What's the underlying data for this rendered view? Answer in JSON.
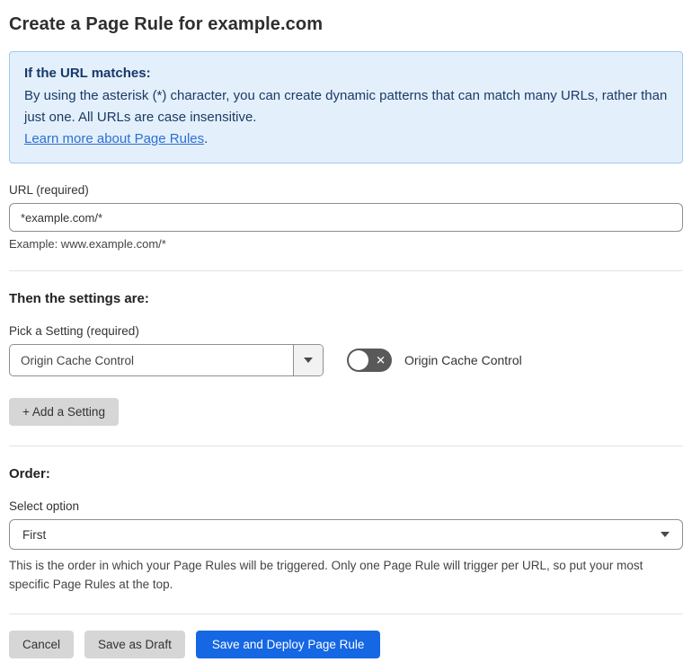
{
  "page": {
    "title": "Create a Page Rule for example.com"
  },
  "info_box": {
    "heading": "If the URL matches:",
    "body": "By using the asterisk (*) character, you can create dynamic patterns that can match many URLs, rather than just one. All URLs are case insensitive.",
    "link_label": "Learn more about Page Rules",
    "link_suffix": "."
  },
  "url_field": {
    "label": "URL (required)",
    "value": "*example.com/*",
    "helper": "Example: www.example.com/*"
  },
  "settings_section": {
    "heading": "Then the settings are:",
    "picker_label": "Pick a Setting (required)",
    "picker_value": "Origin Cache Control",
    "toggle_label": "Origin Cache Control",
    "toggle_state": "off",
    "toggle_icon": "✕",
    "add_setting_label": "+ Add a Setting"
  },
  "order_section": {
    "heading": "Order:",
    "select_label": "Select option",
    "select_value": "First",
    "helper": "This is the order in which your Page Rules will be triggered. Only one Page Rule will trigger per URL, so put your most specific Page Rules at the top."
  },
  "footer": {
    "cancel_label": "Cancel",
    "save_draft_label": "Save as Draft",
    "save_deploy_label": "Save and Deploy Page Rule"
  },
  "colors": {
    "accent_blue": "#1567e4",
    "info_bg": "#e3f0fb",
    "info_border": "#9fc9ef",
    "info_text": "#1b3a66",
    "link_blue": "#2d6fd3",
    "toggle_track": "#595959",
    "button_gray": "#d6d6d6"
  }
}
